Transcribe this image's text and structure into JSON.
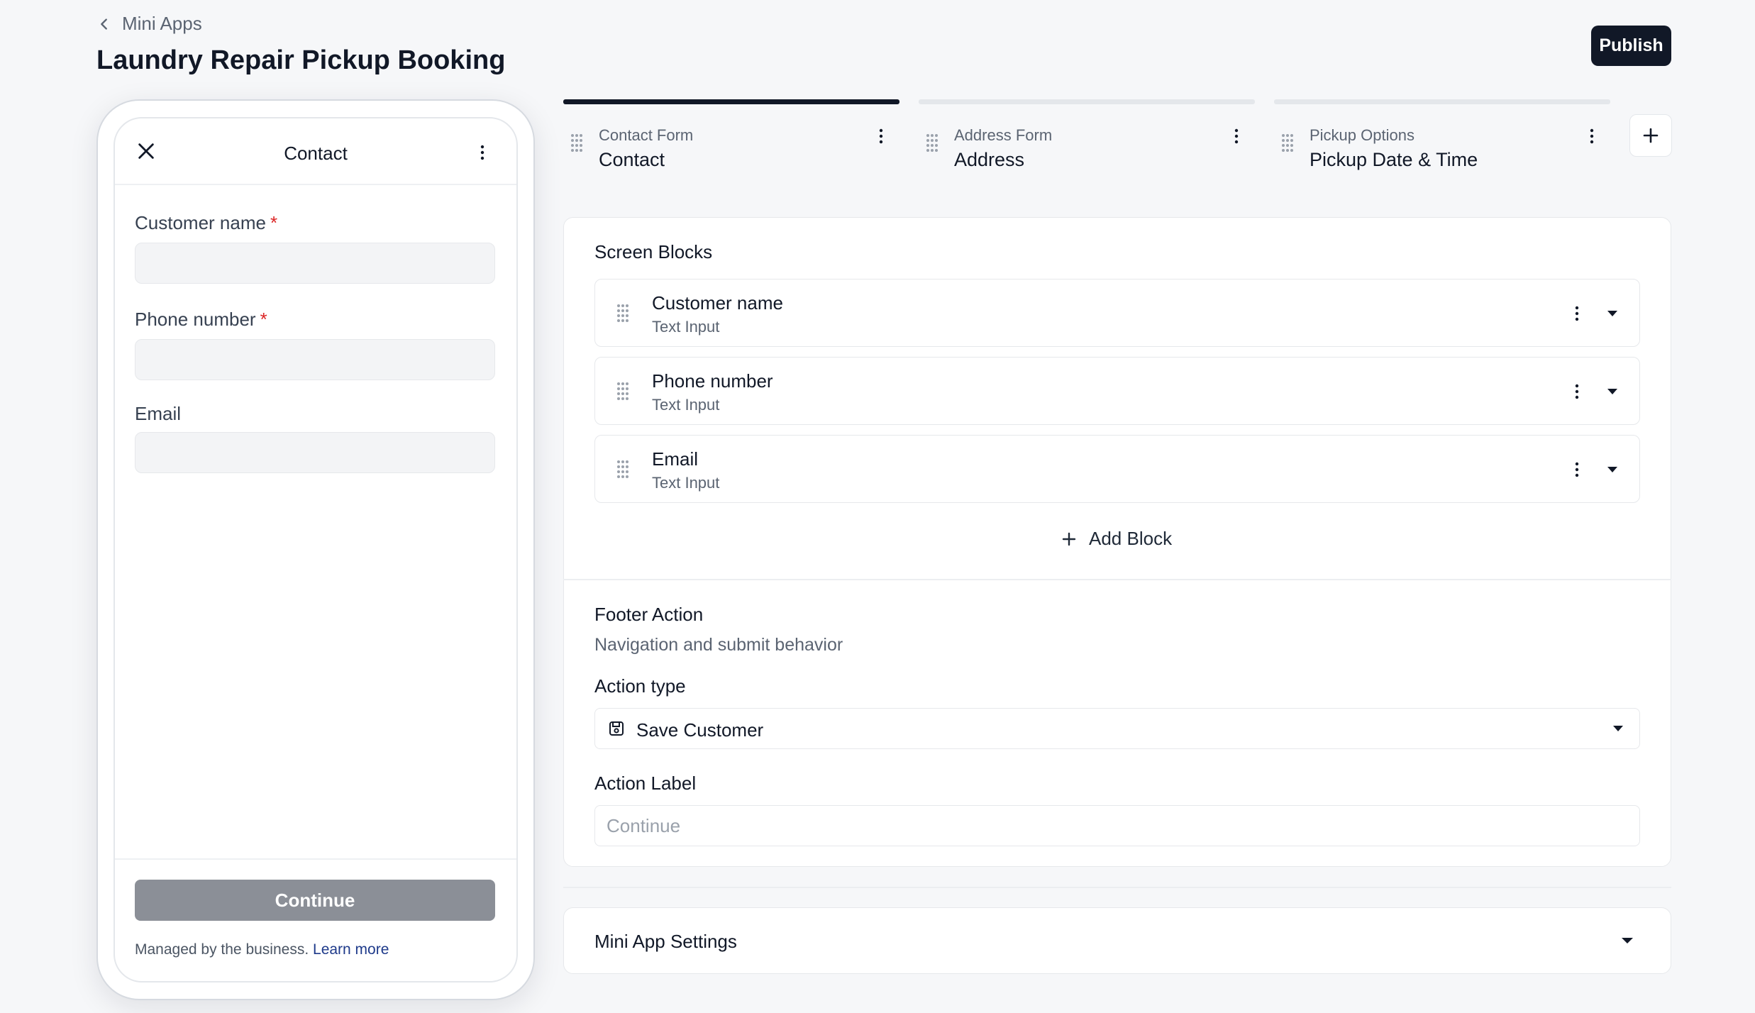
{
  "header": {
    "back_label": "Mini Apps",
    "title": "Laundry Repair Pickup Booking",
    "publish_label": "Publish"
  },
  "preview": {
    "screen_title": "Contact",
    "fields": [
      {
        "label": "Customer name",
        "required_mark": "*",
        "value": ""
      },
      {
        "label": "Phone number",
        "required_mark": "*",
        "value": ""
      },
      {
        "label": "Email",
        "value": ""
      }
    ],
    "continue_label": "Continue",
    "managed_text": "Managed by the business.",
    "learn_more": "Learn more"
  },
  "tabs": [
    {
      "kicker": "Contact Form",
      "name": "Contact",
      "active": true
    },
    {
      "kicker": "Address Form",
      "name": "Address",
      "active": false
    },
    {
      "kicker": "Pickup Options",
      "name": "Pickup Date & Time",
      "active": false
    }
  ],
  "editor": {
    "screen_blocks_title": "Screen Blocks",
    "blocks": [
      {
        "name": "Customer name",
        "type": "Text Input"
      },
      {
        "name": "Phone number",
        "type": "Text Input"
      },
      {
        "name": "Email",
        "type": "Text Input"
      }
    ],
    "add_block_label": "Add Block",
    "footer_title": "Footer Action",
    "footer_subtitle": "Navigation and submit behavior",
    "action_type_label": "Action type",
    "action_type_value": "Save Customer",
    "action_label_title": "Action Label",
    "action_label_placeholder": "Continue",
    "action_label_value": ""
  },
  "settings": {
    "title": "Mini App Settings"
  },
  "icons": {
    "back": "chevron-left-icon",
    "close": "close-icon",
    "more": "kebab-icon",
    "drag": "drag-handle-icon",
    "expand": "chevron-down-icon",
    "add": "plus-icon",
    "save": "floppy-disk-icon"
  },
  "colors": {
    "primary": "#111827",
    "required": "#dc2626",
    "link": "#1e3a8a",
    "disabled_button": "#8b8f97"
  }
}
